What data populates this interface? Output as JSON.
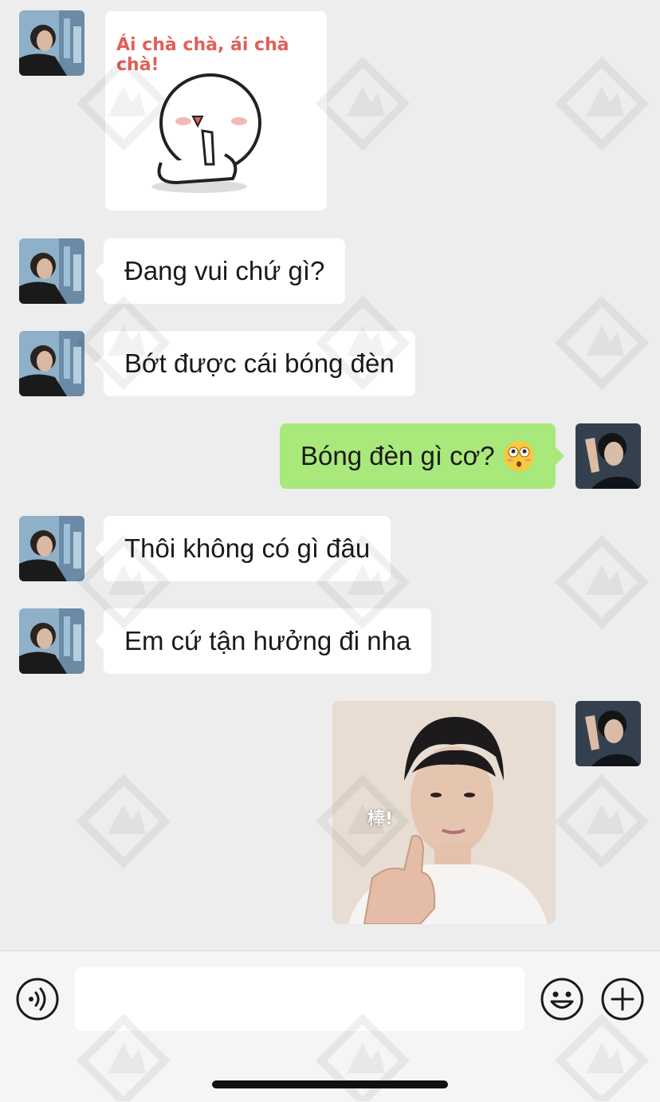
{
  "messages": [
    {
      "side": "in",
      "type": "sticker",
      "text": "Ái chà chà, ái chà chà!"
    },
    {
      "side": "in",
      "type": "text",
      "text": "Đang vui chứ gì?"
    },
    {
      "side": "in",
      "type": "text",
      "text": "Bớt được cái bóng đèn"
    },
    {
      "side": "out",
      "type": "text",
      "text": "Bóng đèn gì cơ?",
      "emoji": "flushed-face"
    },
    {
      "side": "in",
      "type": "text",
      "text": "Thôi không có gì đâu"
    },
    {
      "side": "in",
      "type": "text",
      "text": "Em cứ tận hưởng đi nha"
    },
    {
      "side": "out",
      "type": "image",
      "caption": "棒!"
    }
  ],
  "input": {
    "placeholder": ""
  },
  "icons": {
    "voice": "voice-icon",
    "emoji": "emoji-icon",
    "more": "plus-icon"
  },
  "colors": {
    "background": "#ededed",
    "incoming_bubble": "#ffffff",
    "outgoing_bubble": "#a9e87a"
  },
  "watermark": "微截图"
}
